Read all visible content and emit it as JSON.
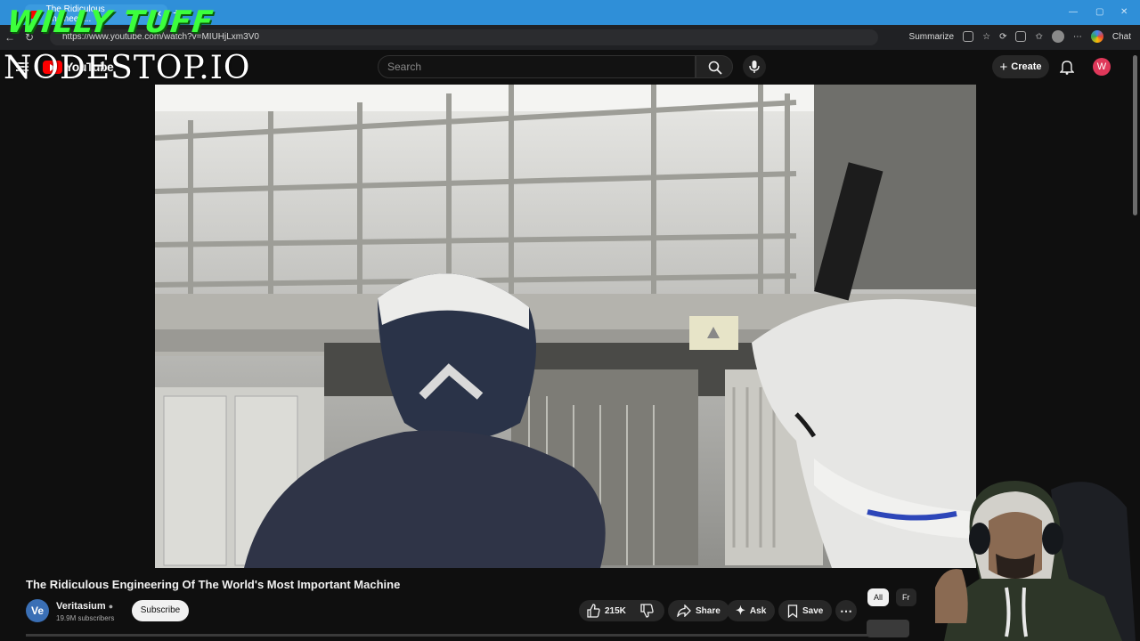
{
  "browser": {
    "tab_title": "The Ridiculous Engineeri...",
    "url": "https://www.youtube.com/watch?v=MIUHjLxm3V0",
    "summarize_label": "Summarize",
    "chat_label": "Chat"
  },
  "overlay": {
    "streamer_name": "WILLY TUFF",
    "watermark": "NODESTOP.IO"
  },
  "youtube": {
    "logo_text": "YouTube",
    "search_placeholder": "Search",
    "create_label": "Create",
    "user_initial": "W"
  },
  "video": {
    "title": "The Ridiculous Engineering Of The World's Most Important Machine",
    "channel_name": "Veritasium",
    "channel_initials": "Ve",
    "subscribers": "19.9M subscribers",
    "subscribe_label": "Subscribe",
    "likes": "215K",
    "share_label": "Share",
    "ask_label": "Ask",
    "save_label": "Save"
  },
  "filters": {
    "all_label": "All",
    "partial_label": "Fr"
  }
}
